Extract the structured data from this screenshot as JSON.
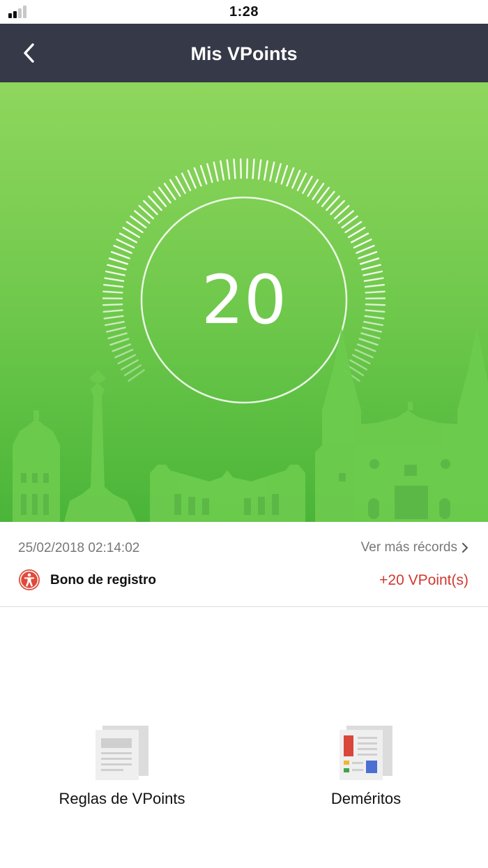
{
  "status_bar": {
    "time": "1:28"
  },
  "header": {
    "title": "Mis VPoints"
  },
  "points": {
    "value": "20"
  },
  "record": {
    "date": "25/02/2018 02:14:02",
    "more_label": "Ver más récords",
    "title": "Bono de registro",
    "points": "+20 VPoint(s)"
  },
  "cards": {
    "rules_label": "Reglas de VPoints",
    "demerits_label": "Deméritos"
  },
  "colors": {
    "nav_bg": "#363947",
    "hero_top": "#8fd65d",
    "hero_bottom": "#4ab539",
    "accent_red": "#d0392e"
  }
}
